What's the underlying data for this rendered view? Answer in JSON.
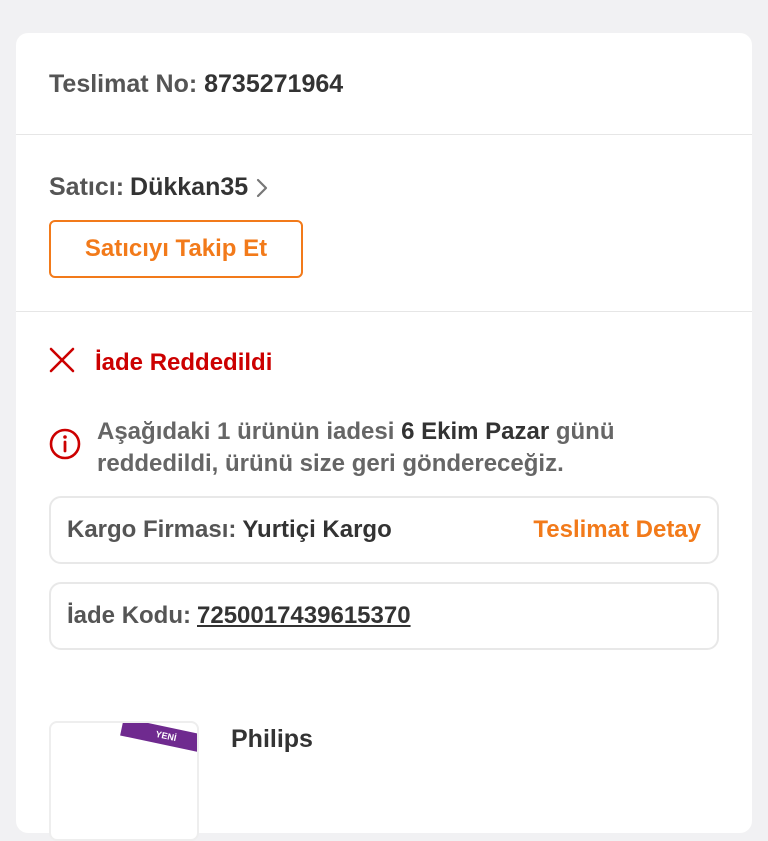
{
  "delivery": {
    "label": "Teslimat No:",
    "number": "8735271964"
  },
  "seller": {
    "label": "Satıcı:",
    "name": "Dükkan35",
    "follow_label": "Satıcıyı Takip Et"
  },
  "status": {
    "text": "İade Reddedildi",
    "color": "#cc0000"
  },
  "info": {
    "part1": "Aşağıdaki 1 ürünün iadesi ",
    "date": "6 Ekim Pazar",
    "part2": " günü reddedildi, ürünü size geri göndereceğiz."
  },
  "shipping": {
    "label": "Kargo Firması:",
    "company": "Yurtiçi Kargo",
    "detail_link": "Teslimat Detay"
  },
  "return_code": {
    "label": "İade Kodu:",
    "code": "7250017439615370"
  },
  "product": {
    "badge": "YENİ",
    "brand": "Philips"
  },
  "colors": {
    "accent": "#f27a1a",
    "error": "#cc0000",
    "badge": "#6f2a8f"
  },
  "icons": {
    "chevron": "chevron-right-icon",
    "status": "close-x-icon",
    "info": "info-circle-icon"
  }
}
